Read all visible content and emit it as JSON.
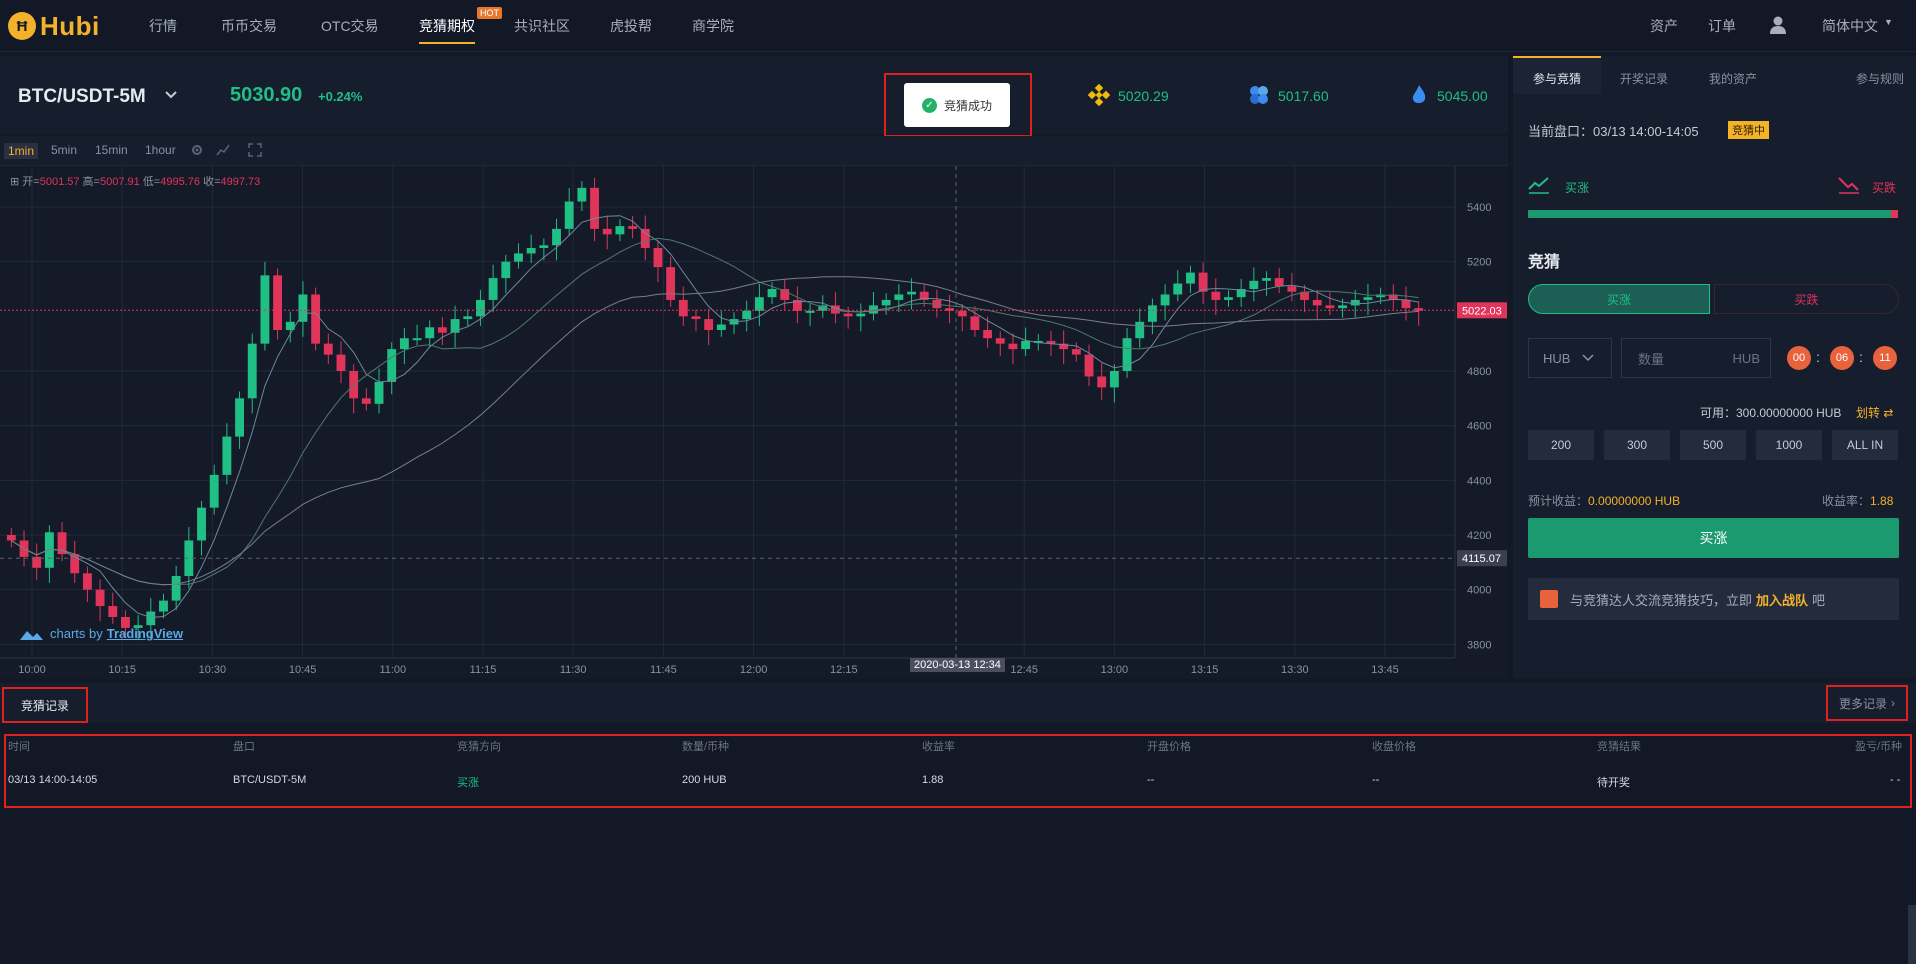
{
  "nav": {
    "logo": "Hubi",
    "items": [
      "行情",
      "币币交易",
      "OTC交易",
      "竞猜期权",
      "共识社区",
      "虎投帮",
      "商学院"
    ],
    "hot_badge": "HOT",
    "right": {
      "assets": "资产",
      "orders": "订单",
      "language": "简体中文"
    }
  },
  "ticker": {
    "pair": "BTC/USDT-5M",
    "price": "5030.90",
    "change": "+0.24%",
    "references": [
      "5020.29",
      "5017.60",
      "5045.00"
    ],
    "reference_icons": [
      "binance-icon",
      "okex-icon",
      "huobi-icon"
    ]
  },
  "toast": {
    "text": "竞猜成功"
  },
  "chart_toolbar": {
    "intervals": [
      "1min",
      "5min",
      "15min",
      "1hour"
    ],
    "active": "1min"
  },
  "chart": {
    "ohlc_labels": {
      "open": "开=",
      "high": "高=",
      "low": "低=",
      "close": "收="
    },
    "ohlc": {
      "open": "5001.57",
      "high": "5007.91",
      "low": "4995.76",
      "close": "4997.73"
    },
    "branding": {
      "prefix": "charts by",
      "name": "TradingView"
    },
    "crosshair_date": "2020-03-13 12:34"
  },
  "chart_data": {
    "type": "candlestick",
    "x_ticks": [
      "10:00",
      "10:15",
      "10:30",
      "10:45",
      "11:00",
      "11:15",
      "11:30",
      "11:45",
      "12:00",
      "12:15",
      "12:45",
      "13:00",
      "13:15",
      "13:30",
      "13:45"
    ],
    "y_ticks": [
      5400,
      5200,
      4800,
      4600,
      4400,
      4200,
      4000,
      3800
    ],
    "ylim": [
      3750,
      5550
    ],
    "last_price_label": "5022.03",
    "crosshair_price_label": "4115.07",
    "close_trend": [
      4180,
      4120,
      4080,
      4210,
      4130,
      4060,
      4000,
      3940,
      3900,
      3860,
      3870,
      3920,
      3960,
      4050,
      4180,
      4300,
      4420,
      4560,
      4700,
      4900,
      5150,
      4950,
      4980,
      5080,
      4900,
      4860,
      4800,
      4700,
      4680,
      4760,
      4880,
      4920,
      4920,
      4960,
      4940,
      4990,
      5000,
      5060,
      5140,
      5200,
      5230,
      5250,
      5260,
      5320,
      5420,
      5470,
      5320,
      5300,
      5330,
      5320,
      5250,
      5180,
      5060,
      5000,
      4990,
      4950,
      4970,
      4990,
      5020,
      5070,
      5100,
      5060,
      5020,
      5020,
      5040,
      5010,
      5000,
      5010,
      5040,
      5060,
      5080,
      5090,
      5060,
      5030,
      5020,
      5000,
      4950,
      4920,
      4900,
      4880,
      4910,
      4910,
      4900,
      4880,
      4860,
      4780,
      4740,
      4800,
      4920,
      4980,
      5040,
      5080,
      5120,
      5160,
      5090,
      5060,
      5070,
      5100,
      5130,
      5140,
      5110,
      5090,
      5060,
      5040,
      5030,
      5040,
      5060,
      5070,
      5080,
      5060,
      5030,
      5020
    ],
    "grid": true
  },
  "right_panel": {
    "tabs": [
      "参与竞猜",
      "开奖记录",
      "我的资产",
      "参与规则"
    ],
    "period_label": "当前盘口：",
    "period_value": "03/13 14:00-14:05",
    "status": "竞猜中",
    "up_label": "买涨",
    "down_label": "买跌",
    "ratio_up": 0.98,
    "guess_title": "竞猜",
    "toggle_up": "买涨",
    "toggle_down": "买跌",
    "unit": "HUB",
    "qty_placeholder": "数量",
    "qty_unit": "HUB",
    "countdown": [
      "00",
      "06",
      "11"
    ],
    "available": "可用：300.00000000 HUB",
    "transfer": "划转",
    "amounts": [
      "200",
      "300",
      "500",
      "1000",
      "ALL IN"
    ],
    "est_label": "预计收益：",
    "est_value": "0.00000000 HUB",
    "rate_label": "收益率：",
    "rate_value": "1.88",
    "buy_button": "买涨",
    "community_pre": "与竞猜达人交流竞猜技巧，立即",
    "community_link": "加入战队",
    "community_post": "吧"
  },
  "records": {
    "title": "竞猜记录",
    "more": "更多记录",
    "headers": [
      "时间",
      "盘口",
      "竞猜方向",
      "数量/币种",
      "收益率",
      "开盘价格",
      "收盘价格",
      "竞猜结果",
      "盈亏/币种"
    ],
    "rows": [
      [
        "03/13 14:00-14:05",
        "BTC/USDT-5M",
        "买涨",
        "200 HUB",
        "1.88",
        "--",
        "--",
        "待开奖",
        "- -"
      ]
    ]
  },
  "colors": {
    "up": "#1fbf86",
    "down": "#e0345b",
    "accent": "#f4b12a",
    "alert": "#e02020"
  }
}
